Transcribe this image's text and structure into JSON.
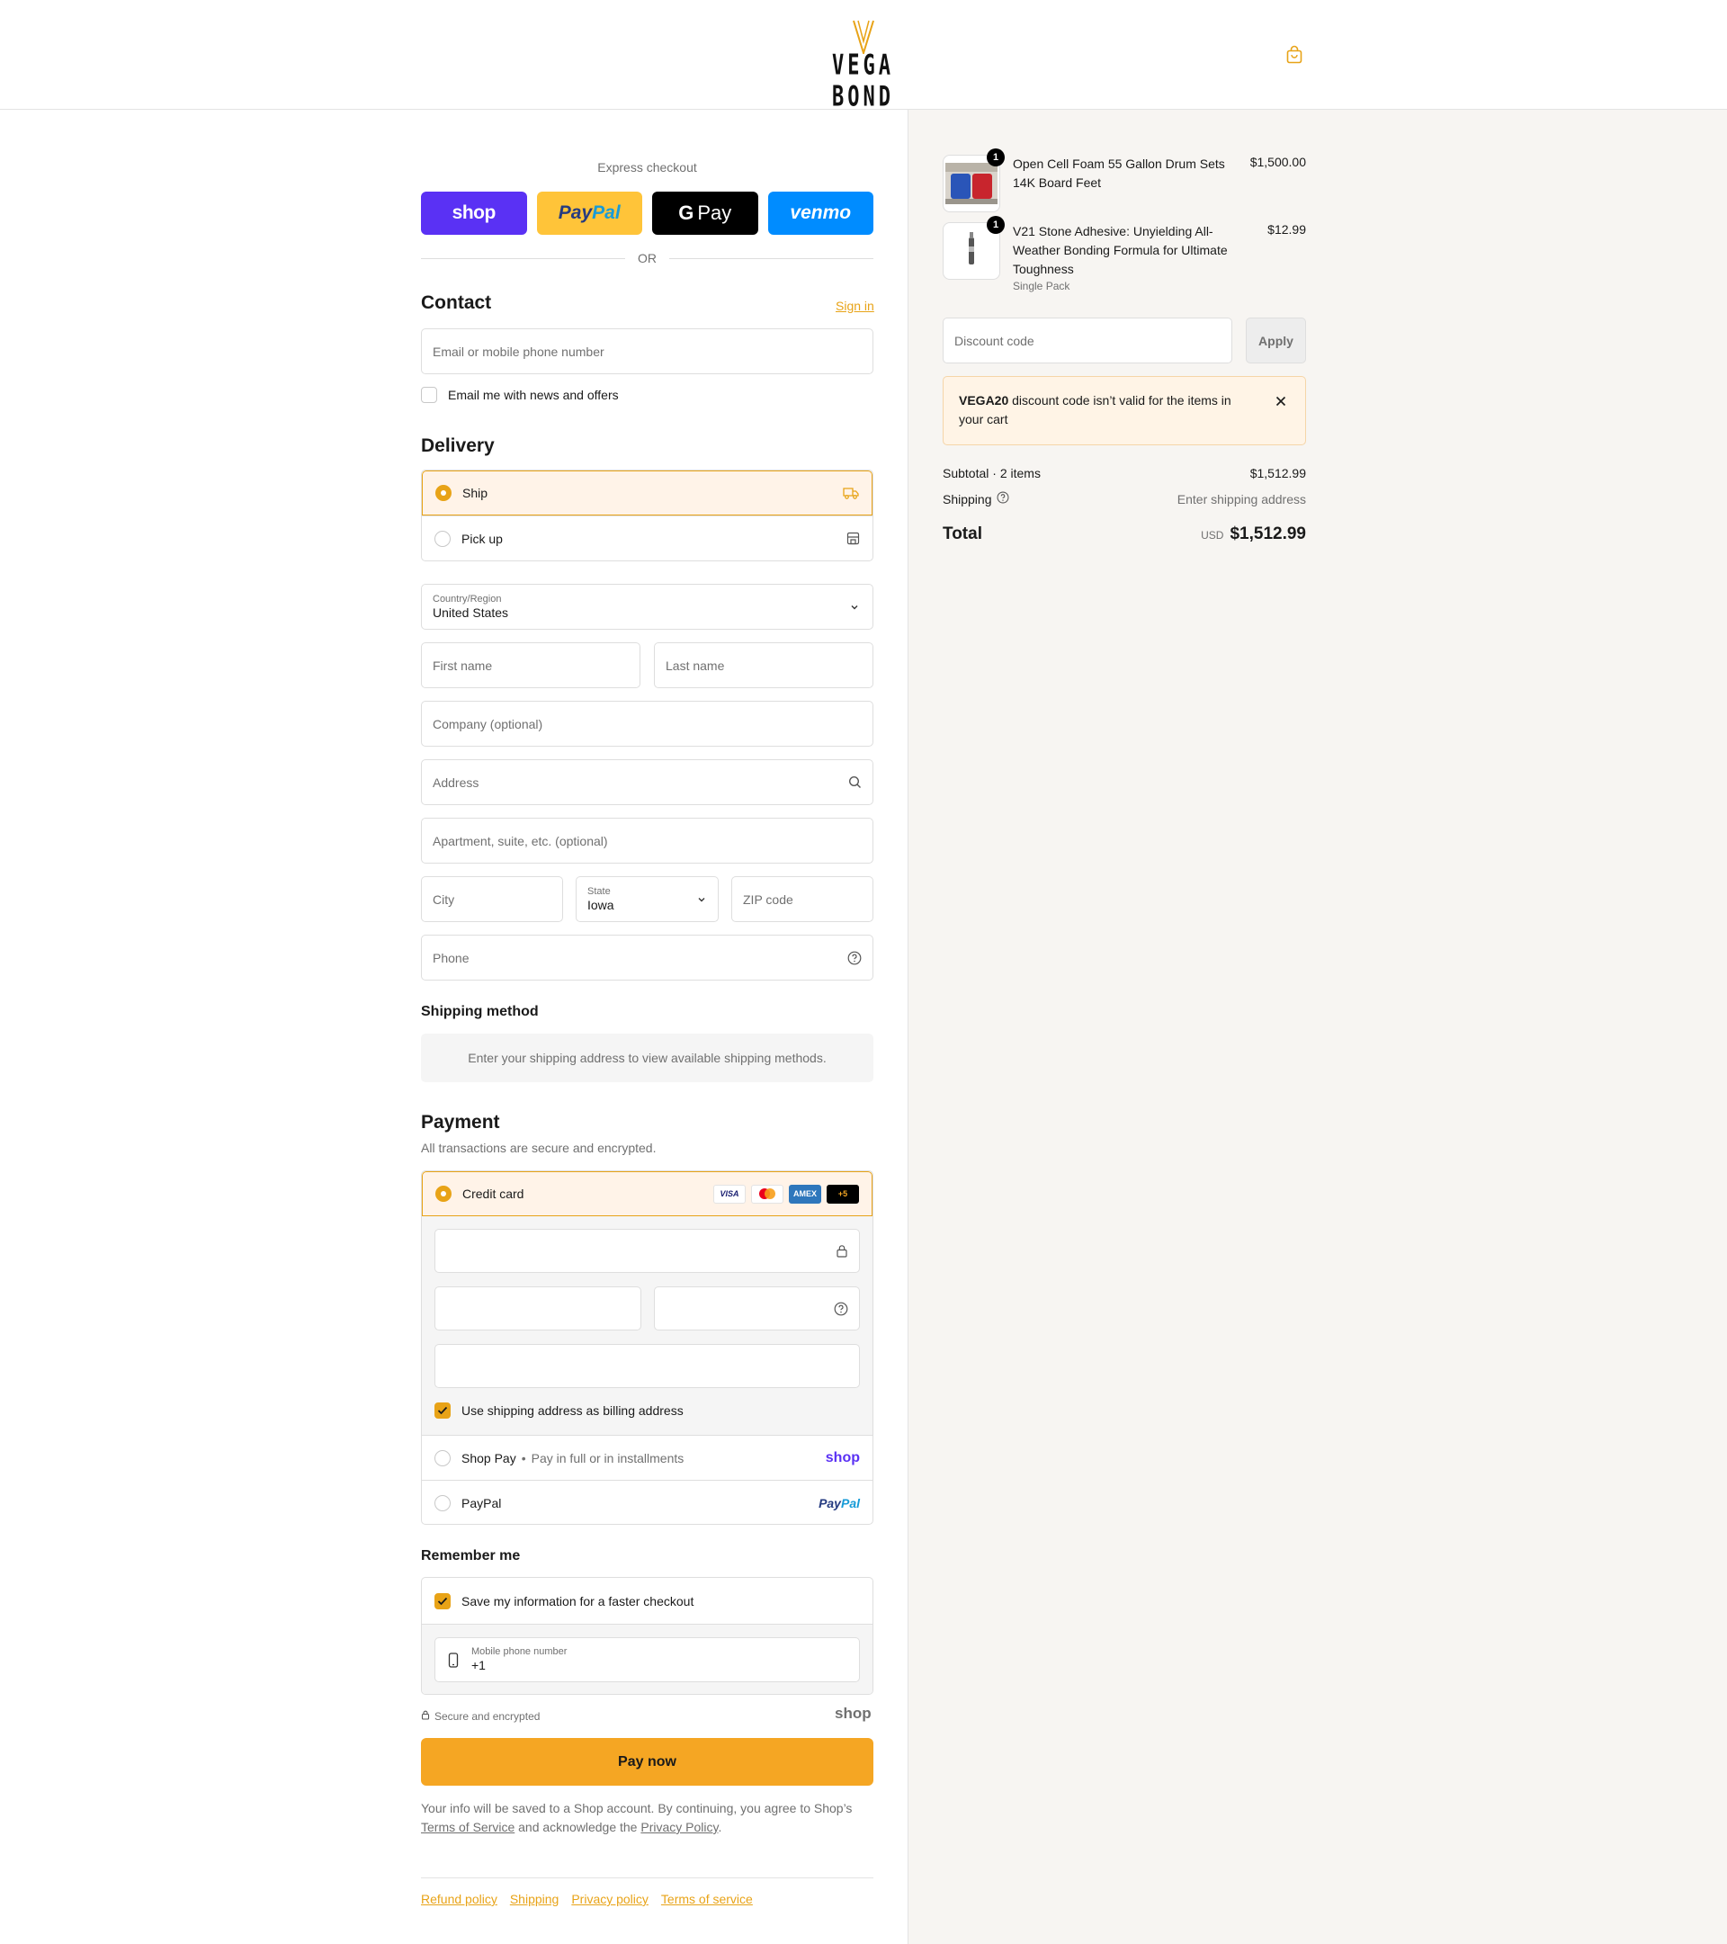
{
  "brand": {
    "logo_text": "VEGA BOND",
    "accent": "#e8a317"
  },
  "express": {
    "title": "Express checkout",
    "buttons": {
      "shop": "shop",
      "paypal_1": "Pay",
      "paypal_2": "Pal",
      "gpay_g": "G",
      "gpay": "Pay",
      "venmo": "venmo"
    },
    "or": "OR"
  },
  "contact": {
    "title": "Contact",
    "signin": "Sign in",
    "email_placeholder": "Email or mobile phone number",
    "newsletter": "Email me with news and offers"
  },
  "delivery": {
    "title": "Delivery",
    "options": [
      {
        "label": "Ship",
        "selected": true
      },
      {
        "label": "Pick up",
        "selected": false
      }
    ],
    "country_label": "Country/Region",
    "country_value": "United States",
    "first_name": "First name",
    "last_name": "Last name",
    "company": "Company (optional)",
    "address": "Address",
    "apartment": "Apartment, suite, etc. (optional)",
    "city": "City",
    "state_label": "State",
    "state_value": "Iowa",
    "zip": "ZIP code",
    "phone": "Phone"
  },
  "shipping_method": {
    "title": "Shipping method",
    "notice": "Enter your shipping address to view available shipping methods."
  },
  "payment": {
    "title": "Payment",
    "subtitle": "All transactions are secure and encrypted.",
    "credit_card": "Credit card",
    "cards": {
      "visa": "VISA",
      "amex": "AMEX",
      "more": "+5"
    },
    "billing_same": "Use shipping address as billing address",
    "shop_pay": "Shop Pay",
    "shop_pay_sep": "•",
    "shop_pay_desc": "Pay in full or in installments",
    "shop_pay_logo": "shop",
    "paypal": "PayPal",
    "paypal_logo_1": "Pay",
    "paypal_logo_2": "Pal"
  },
  "remember": {
    "title": "Remember me",
    "save": "Save my information for a faster checkout",
    "mobile_label": "Mobile phone number",
    "mobile_value": "+1",
    "secure": "Secure and encrypted",
    "shop_logo": "shop"
  },
  "pay_now": "Pay now",
  "legal": {
    "text_1": "Your info will be saved to a Shop account. By continuing, you agree to Shop’s",
    "tos": "Terms of Service",
    "text_2": "and acknowledge the",
    "privacy": "Privacy Policy",
    "text_3": "."
  },
  "footer": {
    "links": [
      "Refund policy",
      "Shipping",
      "Privacy policy",
      "Terms of service"
    ]
  },
  "cart": {
    "items": [
      {
        "name": "Open Cell Foam 55 Gallon Drum Sets 14K Board Feet",
        "variant": "",
        "qty": "1",
        "price": "$1,500.00"
      },
      {
        "name": "V21 Stone Adhesive: Unyielding All-Weather Bonding Formula for Ultimate Toughness",
        "variant": "Single Pack",
        "qty": "1",
        "price": "$12.99"
      }
    ],
    "discount_placeholder": "Discount code",
    "apply": "Apply",
    "error_code": "VEGA20",
    "error_text": "discount code isn’t valid for the items in your cart",
    "subtotal_label": "Subtotal · 2 items",
    "subtotal_value": "$1,512.99",
    "shipping_label": "Shipping",
    "shipping_value": "Enter shipping address",
    "total_label": "Total",
    "total_currency": "USD",
    "total_value": "$1,512.99"
  }
}
